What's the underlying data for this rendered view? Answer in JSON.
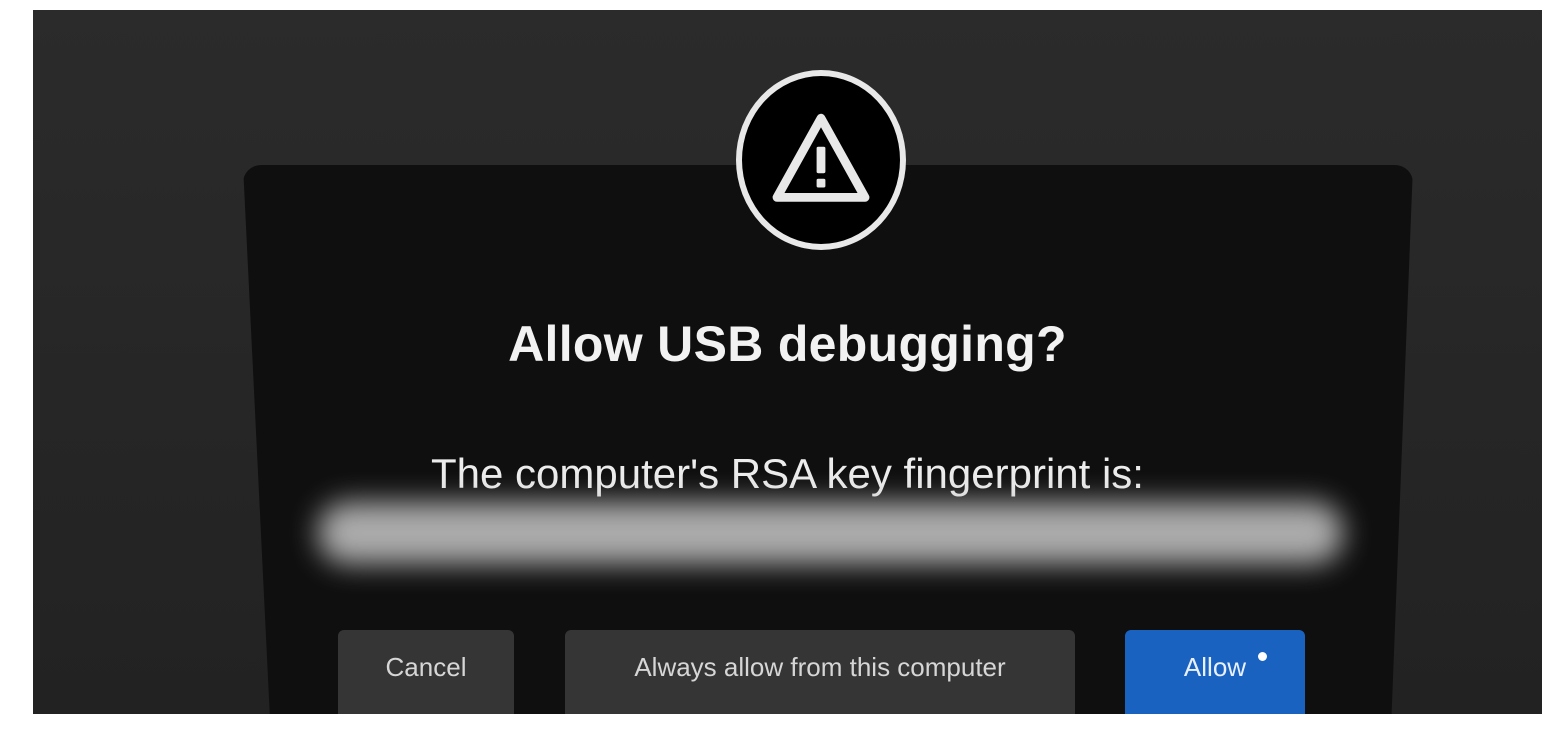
{
  "dialog": {
    "icon": "warning-triangle-icon",
    "title": "Allow USB debugging?",
    "message": "The computer's RSA key fingerprint is:"
  },
  "buttons": {
    "cancel_label": "Cancel",
    "always_allow_label": "Always allow from this computer",
    "allow_label": "Allow"
  },
  "colors": {
    "allow_button": "#1a62c0",
    "secondary_button": "#353535",
    "dialog_background": "#0f0f0f"
  }
}
